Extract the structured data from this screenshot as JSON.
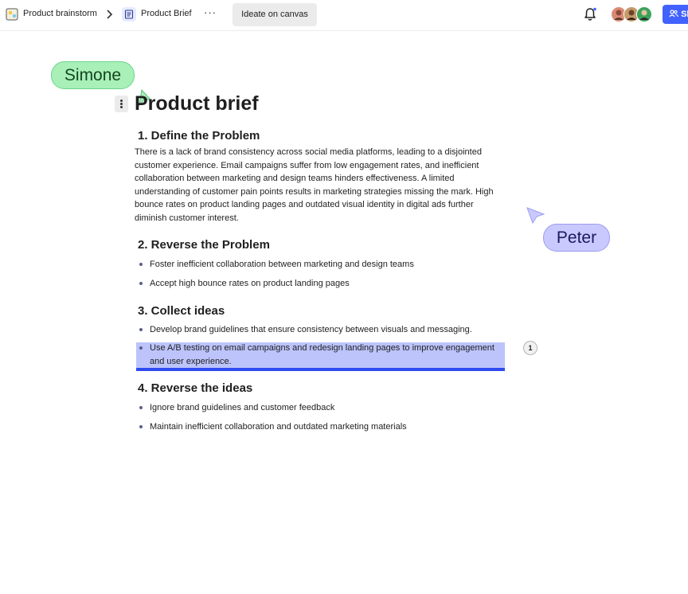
{
  "topbar": {
    "board_name": "Product brainstorm",
    "doc_name": "Product Brief",
    "more": "···",
    "ideate_label": "Ideate on canvas",
    "share_label": "Share"
  },
  "avatars": [
    {
      "name": "avatar-1",
      "color": "#d98a74"
    },
    {
      "name": "avatar-2",
      "color": "#a36b3f"
    },
    {
      "name": "avatar-3",
      "color": "#3aa35a"
    }
  ],
  "collaborators": {
    "simone": {
      "name": "Simone",
      "color": "#a8efb8"
    },
    "peter": {
      "name": "Peter",
      "color": "#c9c9ff"
    }
  },
  "document": {
    "title": "Product brief",
    "sections": [
      {
        "heading": "1. Define the Problem",
        "paragraph": "There is a lack of brand consistency across social media platforms, leading to a disjointed customer experience. Email campaigns suffer from low engagement rates, and inefficient collaboration between marketing and design teams hinders effectiveness. A limited understanding of customer pain points results in marketing strategies missing the mark. High bounce rates on product landing pages and outdated visual identity in digital ads further diminish customer interest."
      },
      {
        "heading": "2. Reverse the Problem",
        "bullets": [
          "Foster inefficient collaboration between marketing and design teams",
          "Accept high bounce rates on product landing pages"
        ]
      },
      {
        "heading": "3. Collect ideas",
        "bullets": [
          "Develop brand guidelines that ensure consistency between visuals and messaging.",
          "Use A/B testing on email campaigns and redesign landing pages to improve engagement and user experience."
        ]
      },
      {
        "heading": "4. Reverse the ideas",
        "bullets": [
          "Ignore brand guidelines and customer feedback",
          "Maintain inefficient collaboration and outdated marketing materials"
        ]
      }
    ]
  },
  "comment_count": "1",
  "colors": {
    "accent": "#4262ff",
    "highlight": "#bcc4fb",
    "selection_bar": "#2f4bf0"
  }
}
